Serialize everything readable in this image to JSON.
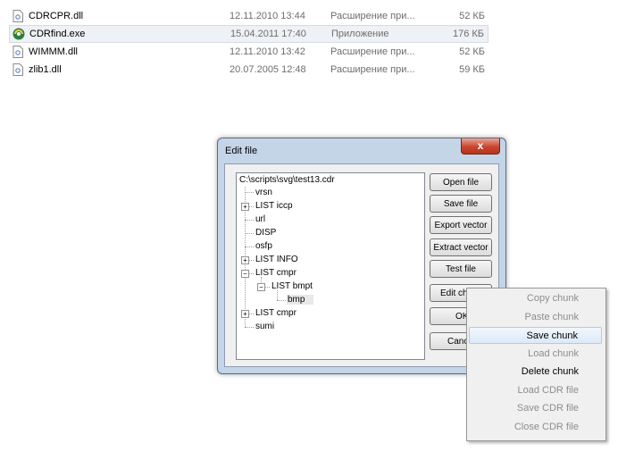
{
  "files": [
    {
      "name": "CDRCPR.dll",
      "date": "12.11.2010 13:44",
      "type": "Расширение при...",
      "size": "52 КБ",
      "icon": "dll-file-icon"
    },
    {
      "name": "CDRfind.exe",
      "date": "15.04.2011 17:40",
      "type": "Приложение",
      "size": "176 КБ",
      "icon": "exe-app-icon"
    },
    {
      "name": "WIMMM.dll",
      "date": "12.11.2010 13:42",
      "type": "Расширение при...",
      "size": "52 КБ",
      "icon": "dll-file-icon"
    },
    {
      "name": "zlib1.dll",
      "date": "20.07.2005 12:48",
      "type": "Расширение при...",
      "size": "59 КБ",
      "icon": "dll-file-icon"
    }
  ],
  "dialog": {
    "title": "Edit file",
    "close_glyph": "x",
    "tree": {
      "root": "C:\\scripts\\svg\\test13.cdr",
      "nodes": [
        "vrsn",
        "LIST  iccp",
        "url",
        "DISP",
        "osfp",
        "LIST  INFO",
        "LIST  cmpr",
        "LIST  bmpt",
        "bmp",
        "LIST  cmpr",
        "sumi"
      ]
    },
    "buttons": {
      "open": "Open file",
      "save": "Save file",
      "export_vector": "Export vector",
      "extract_vector": "Extract vector",
      "test": "Test file",
      "edit_chunk": "Edit chu",
      "ok": "OK",
      "cancel": "Canc"
    }
  },
  "context_menu": {
    "items": [
      {
        "label": "Copy chunk",
        "state": "disabled"
      },
      {
        "label": "Paste chunk",
        "state": "disabled"
      },
      {
        "label": "Save chunk",
        "state": "hover"
      },
      {
        "label": "Load chunk",
        "state": "disabled"
      },
      {
        "label": "Delete chunk",
        "state": "enabled"
      },
      {
        "label": "Load CDR file",
        "state": "disabled"
      },
      {
        "label": "Save CDR file",
        "state": "disabled"
      },
      {
        "label": "Close CDR file",
        "state": "disabled"
      }
    ]
  },
  "colors": {
    "dialog_frame": "#c5d5e8",
    "close_button": "#c7462e",
    "selected_row": "#eef1f6"
  }
}
